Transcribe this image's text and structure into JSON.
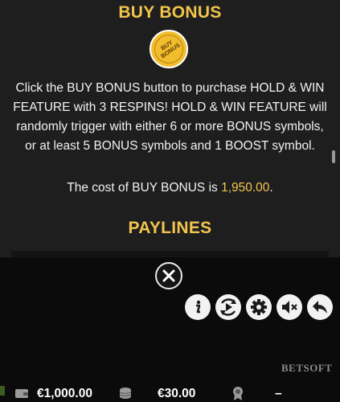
{
  "paytable": {
    "buy_bonus_title": "BUY BONUS",
    "badge_text_line1": "BUY",
    "badge_text_line2": "BONUS",
    "description": "Click the BUY BONUS button to purchase HOLD & WIN FEATURE with 3 RESPINS! HOLD & WIN FEATURE will randomly trigger with either 6 or more BONUS symbols, or at least 5 BONUS symbols and 1 BOOST symbol.",
    "cost_prefix": "The cost of BUY BONUS is ",
    "cost_amount": "1,950.00",
    "cost_suffix": ".",
    "paylines_title": "PAYLINES"
  },
  "controls": {
    "close": "close-icon",
    "info": "info-icon",
    "autoplay": "autoplay-icon",
    "settings": "gear-icon",
    "sound": "mute-icon",
    "back": "back-icon"
  },
  "branding": {
    "logo_text": "BETSOFT"
  },
  "bottom_bar": {
    "balance": "€1,000.00",
    "bet": "€30.00",
    "win": "–"
  },
  "colors": {
    "accent": "#f3c54d",
    "panel": "#1e1e1e",
    "background": "#0b0b0b"
  }
}
